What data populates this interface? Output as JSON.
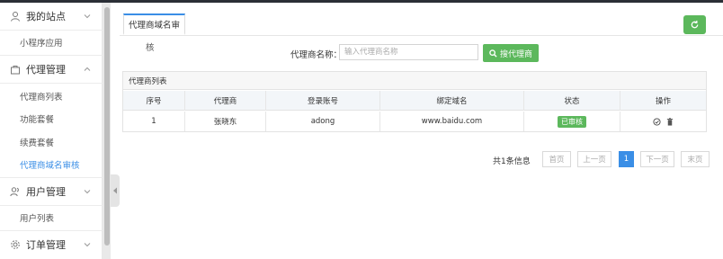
{
  "sidebar": {
    "groups": [
      {
        "label": "我的站点",
        "icon": "user-icon",
        "items": [
          {
            "label": "小程序应用"
          }
        ]
      },
      {
        "label": "代理管理",
        "icon": "shopping-bag-icon",
        "items": [
          {
            "label": "代理商列表"
          },
          {
            "label": "功能套餐"
          },
          {
            "label": "续费套餐"
          },
          {
            "label": "代理商域名审核",
            "active": true
          }
        ]
      },
      {
        "label": "用户管理",
        "icon": "users-icon",
        "items": [
          {
            "label": "用户列表"
          }
        ]
      },
      {
        "label": "订单管理",
        "icon": "gear-icon",
        "items": []
      }
    ]
  },
  "tab": {
    "label": "代理商域名审"
  },
  "filter": {
    "hidden_label": "核",
    "name_label": "代理商名称：",
    "name_placeholder": "输入代理商名称",
    "search_button": "搜代理商"
  },
  "table": {
    "title": "代理商列表",
    "columns": [
      "序号",
      "代理商",
      "登录账号",
      "绑定域名",
      "状态",
      "操作"
    ],
    "rows": [
      {
        "index": "1",
        "agent": "张晓东",
        "account": "adong",
        "domain": "www.baidu.com",
        "status": "已审核"
      }
    ]
  },
  "pager": {
    "total": "共1条信息",
    "first": "首页",
    "prev": "上一页",
    "current": "1",
    "next": "下一页",
    "last": "末页"
  },
  "colors": {
    "accent": "#3a8ee6",
    "success": "#5cb85c"
  }
}
